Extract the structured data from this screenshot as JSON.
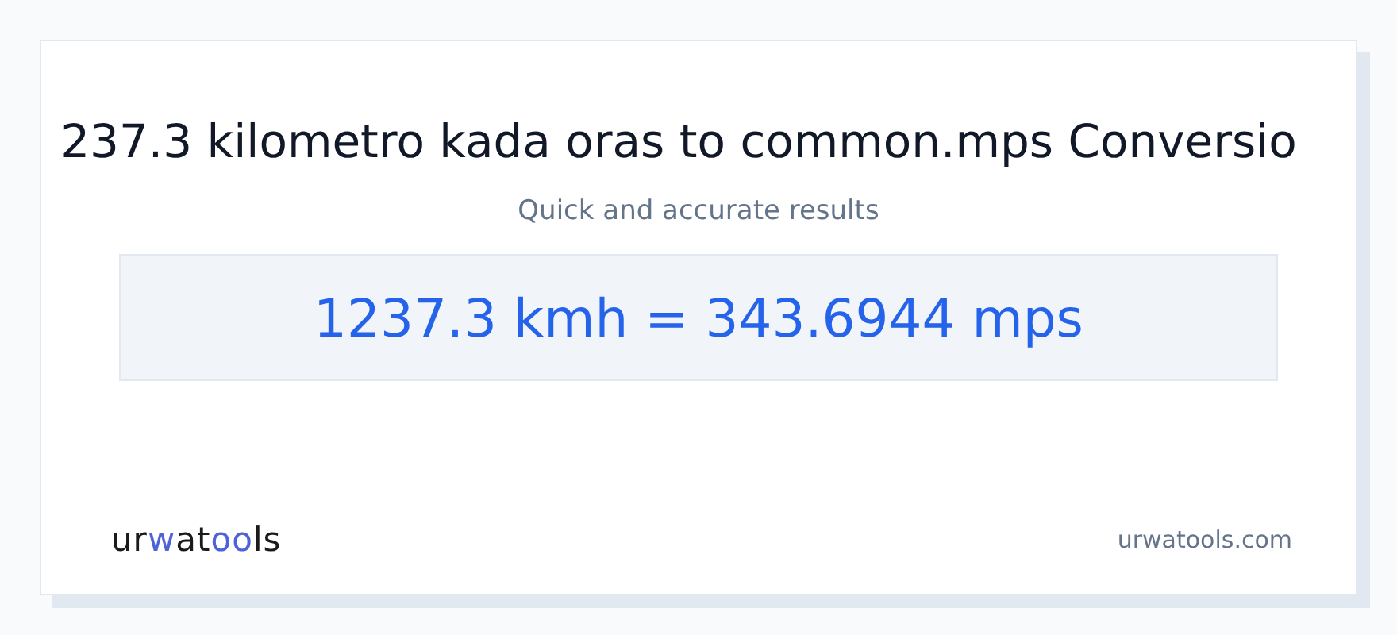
{
  "title": "237.3 kilometro kada oras to common.mps Conversio",
  "subtitle": "Quick and accurate results",
  "result": "1237.3 kmh = 343.6944 mps",
  "logo": [
    {
      "text": "ur",
      "color": "#1a1a1a"
    },
    {
      "text": "w",
      "color": "#4f63d9"
    },
    {
      "text": "at",
      "color": "#1a1a1a"
    },
    {
      "text": "oo",
      "color": "#4f63d9"
    },
    {
      "text": "ls",
      "color": "#1a1a1a"
    }
  ],
  "site": "urwatools.com"
}
